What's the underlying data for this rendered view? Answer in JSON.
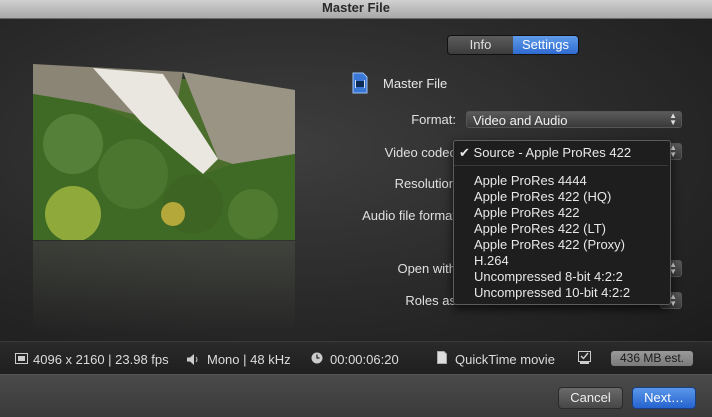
{
  "window": {
    "title": "Master File"
  },
  "tabs": [
    {
      "label": "Info",
      "selected": false
    },
    {
      "label": "Settings",
      "selected": true
    }
  ],
  "header": {
    "title": "Master File",
    "icon": "film-file-icon"
  },
  "fields": {
    "format": {
      "label": "Format:",
      "value": "Video and Audio"
    },
    "video_codec": {
      "label": "Video codec"
    },
    "resolution": {
      "label": "Resolution"
    },
    "audio_file_format": {
      "label": "Audio file format"
    },
    "open_with": {
      "label": "Open with"
    },
    "roles_as": {
      "label": "Roles as"
    }
  },
  "codec_menu": {
    "selected": "Source - Apple ProRes 422",
    "check": "✔",
    "options": [
      "Apple ProRes 4444",
      "Apple ProRes 422 (HQ)",
      "Apple ProRes 422",
      "Apple ProRes 422 (LT)",
      "Apple ProRes 422 (Proxy)",
      "H.264",
      "Uncompressed 8-bit 4:2:2",
      "Uncompressed 10-bit 4:2:2"
    ]
  },
  "status": {
    "video": "4096 x 2160 | 23.98 fps",
    "audio": "Mono | 48 kHz",
    "duration": "00:00:06:20",
    "container": "QuickTime movie",
    "size": "436 MB est."
  },
  "buttons": {
    "cancel": "Cancel",
    "next": "Next…"
  },
  "colors": {
    "accent": "#2f6bd1",
    "background": "#2a2a2a"
  }
}
